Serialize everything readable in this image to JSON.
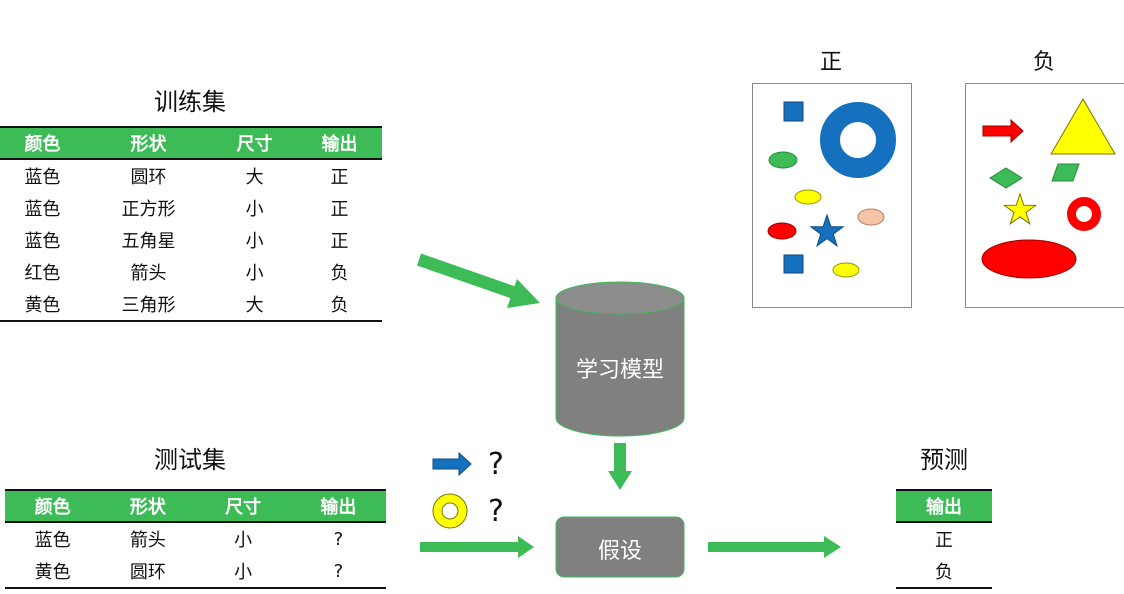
{
  "training": {
    "title": "训练集",
    "headers": [
      "颜色",
      "形状",
      "尺寸",
      "输出"
    ],
    "rows": [
      [
        "蓝色",
        "圆环",
        "大",
        "正"
      ],
      [
        "蓝色",
        "正方形",
        "小",
        "正"
      ],
      [
        "蓝色",
        "五角星",
        "小",
        "正"
      ],
      [
        "红色",
        "箭头",
        "小",
        "负"
      ],
      [
        "黄色",
        "三角形",
        "大",
        "负"
      ]
    ]
  },
  "test": {
    "title": "测试集",
    "headers": [
      "颜色",
      "形状",
      "尺寸",
      "输出"
    ],
    "rows": [
      [
        "蓝色",
        "箭头",
        "小",
        "?"
      ],
      [
        "黄色",
        "圆环",
        "小",
        "?"
      ]
    ]
  },
  "prediction": {
    "title": "预测",
    "header": "输出",
    "rows": [
      "正",
      "负"
    ]
  },
  "model_label": "学习模型",
  "hypothesis_label": "假设",
  "positive_title": "正",
  "negative_title": "负",
  "query_mark": "?",
  "colors": {
    "accent_green": "#3dbb57",
    "model_gray": "#808080",
    "blue": "#1670c0",
    "red": "#ff0000",
    "yellow": "#ffff00"
  }
}
